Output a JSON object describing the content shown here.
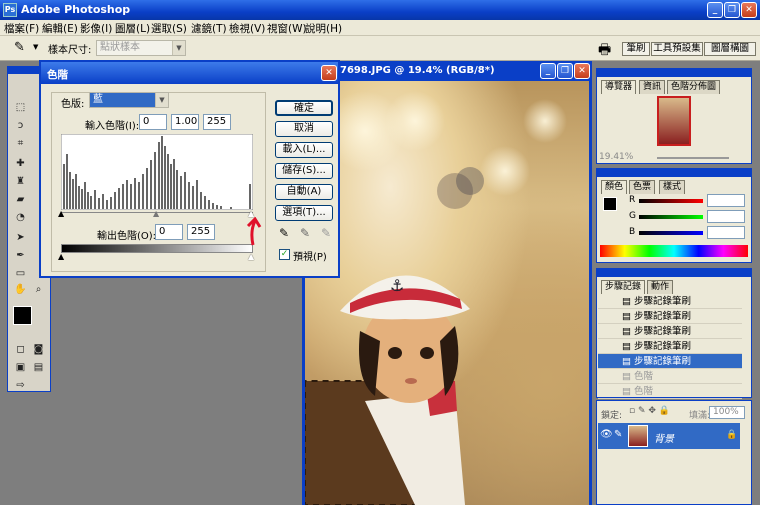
{
  "app": {
    "title": "Adobe Photoshop",
    "logo": "Ps"
  },
  "window_controls": {
    "minimize": "_",
    "restore": "❐",
    "close": "✕"
  },
  "menu": [
    "檔案(F)",
    "編輯(E)",
    "影像(I)",
    "圖層(L)",
    "選取(S)",
    "濾鏡(T)",
    "檢視(V)",
    "視窗(W)",
    "說明(H)"
  ],
  "options_bar": {
    "sample_size_label": "樣本尺寸:",
    "sample_size_value": "點狀樣本",
    "tabs": [
      "筆刷",
      "工具預設集",
      "圖層構圖"
    ]
  },
  "document": {
    "title": "7698.JPG @ 19.4% (RGB/8*)"
  },
  "levels": {
    "title": "色階",
    "channel_label": "色版:",
    "channel_value": "藍",
    "input_label": "輸入色階(I):",
    "input_values": [
      "0",
      "1.00",
      "255"
    ],
    "output_label": "輸出色階(O):",
    "output_values": [
      "0",
      "255"
    ],
    "buttons": [
      "確定",
      "取消",
      "載入(L)...",
      "儲存(S)...",
      "自動(A)",
      "選項(T)..."
    ],
    "preview_label": "預視(P)",
    "preview_checked": true
  },
  "navigator": {
    "tabs": [
      "導覽器",
      "資訊",
      "色階分佈圖"
    ],
    "zoom": "19.41%"
  },
  "color": {
    "tabs": [
      "顏色",
      "色票",
      "樣式"
    ],
    "channels": [
      {
        "name": "R",
        "value": ""
      },
      {
        "name": "G",
        "value": ""
      },
      {
        "name": "B",
        "value": ""
      }
    ]
  },
  "history": {
    "tabs": [
      "步驟記錄",
      "動作"
    ],
    "items": [
      {
        "label": "步驟記錄筆刷",
        "state": "normal"
      },
      {
        "label": "步驟記錄筆刷",
        "state": "normal"
      },
      {
        "label": "步驟記錄筆刷",
        "state": "normal"
      },
      {
        "label": "步驟記錄筆刷",
        "state": "normal"
      },
      {
        "label": "步驟記錄筆刷",
        "state": "selected"
      },
      {
        "label": "色階",
        "state": "dimmed"
      },
      {
        "label": "色階",
        "state": "dimmed"
      }
    ]
  },
  "layers": {
    "lock_label": "鎖定:",
    "fill_label": "填滿:",
    "fill_value": "100%",
    "layer_name": "背景"
  },
  "colors": {
    "title_blue": "#0a3fc7",
    "selection": "#316ac5",
    "annotation_red": "#e0102a"
  }
}
